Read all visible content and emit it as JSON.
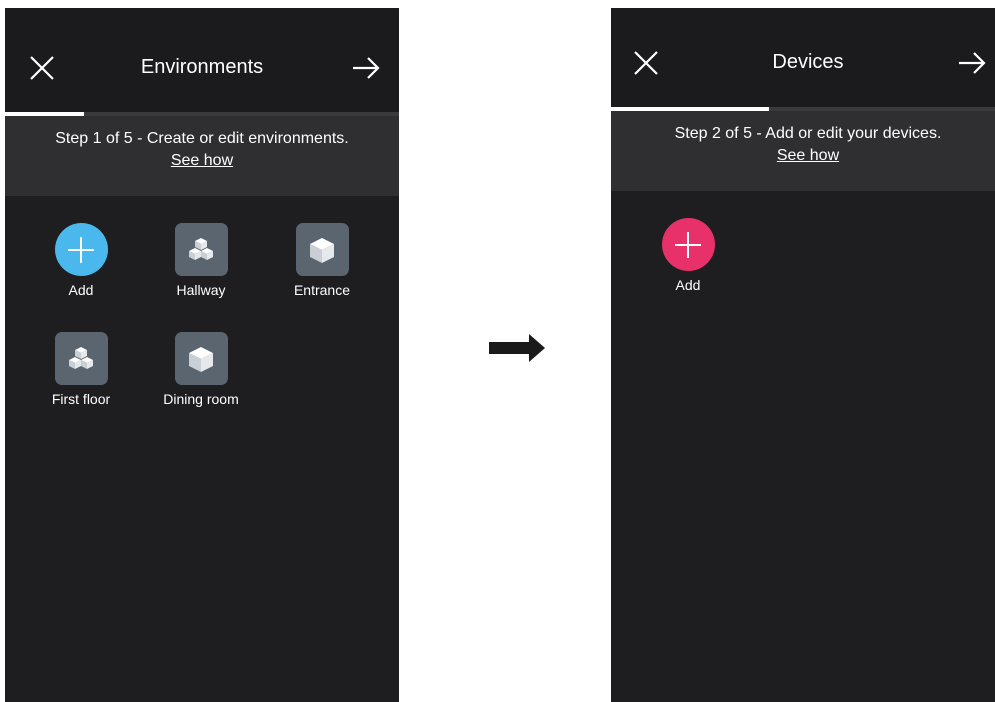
{
  "left_screen": {
    "title": "Environments",
    "step_text": "Step 1 of 5 - Create or edit environments.",
    "see_how": "See how",
    "progress": 0.2,
    "add_color": "#4ab8ec",
    "tiles": [
      {
        "label": "Add",
        "icon": "plus-icon"
      },
      {
        "label": "Hallway",
        "icon": "cubes-icon"
      },
      {
        "label": "Entrance",
        "icon": "cube-icon"
      },
      {
        "label": "First floor",
        "icon": "cubes-icon"
      },
      {
        "label": "Dining room",
        "icon": "cube-icon"
      }
    ]
  },
  "right_screen": {
    "title": "Devices",
    "step_text": "Step 2 of 5 - Add or edit your devices.",
    "see_how": "See how",
    "progress": 0.4,
    "add_color": "#e8306a",
    "tiles": [
      {
        "label": "Add",
        "icon": "plus-icon"
      }
    ]
  }
}
